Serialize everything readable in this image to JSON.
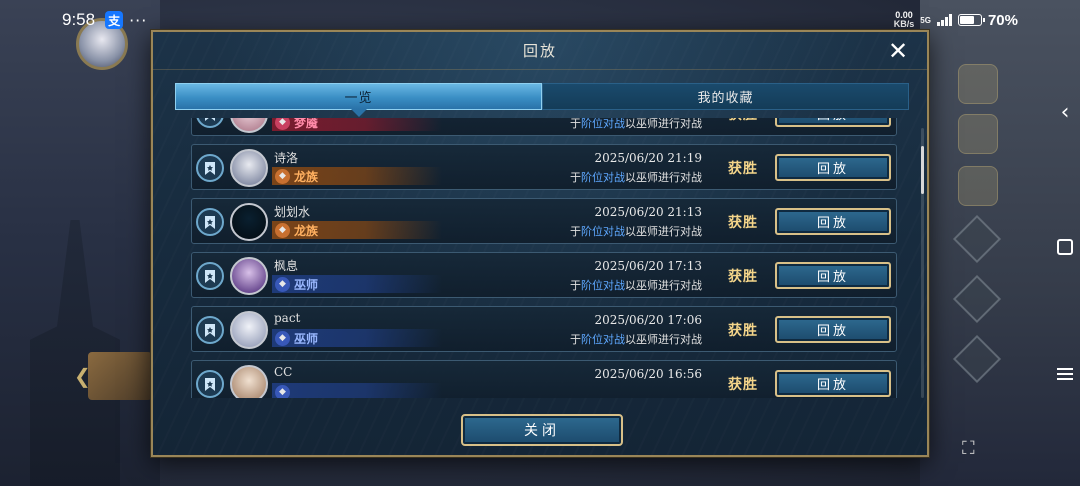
{
  "status_bar": {
    "time": "9:58",
    "app_badge": "支",
    "more": "···",
    "net_speed_value": "0.00",
    "net_speed_unit": "KB/s",
    "net_type": "5G",
    "battery": "70%",
    "battery_level": 0.7
  },
  "dialog": {
    "title": "回放",
    "tabs": [
      {
        "label": "一览",
        "active": true
      },
      {
        "label": "我的收藏",
        "active": false
      }
    ],
    "close_label": "关闭",
    "scroll_position": 0.08
  },
  "replays": [
    {
      "name": "",
      "class": "梦魇",
      "class_theme": "nightmare",
      "date": "",
      "desc_prefix": "于",
      "mode": "阶位对战",
      "desc_suffix": "以巫师进行对战",
      "result": "获胜",
      "button": "回放",
      "avatar": "pink"
    },
    {
      "name": "诗洛",
      "class": "龙族",
      "class_theme": "dragon",
      "date": "2025/06/20  21:19",
      "desc_prefix": "于",
      "mode": "阶位对战",
      "desc_suffix": "以巫师进行对战",
      "result": "获胜",
      "button": "回放",
      "avatar": "silver"
    },
    {
      "name": "划划水",
      "class": "龙族",
      "class_theme": "dragon",
      "date": "2025/06/20  21:13",
      "desc_prefix": "于",
      "mode": "阶位对战",
      "desc_suffix": "以巫师进行对战",
      "result": "获胜",
      "button": "回放",
      "avatar": "dark"
    },
    {
      "name": "枫息",
      "class": "巫师",
      "class_theme": "wizard",
      "date": "2025/06/20  17:13",
      "desc_prefix": "于",
      "mode": "阶位对战",
      "desc_suffix": "以巫师进行对战",
      "result": "获胜",
      "button": "回放",
      "avatar": "purple"
    },
    {
      "name": "pact",
      "class": "巫师",
      "class_theme": "wizard",
      "date": "2025/06/20  17:06",
      "desc_prefix": "于",
      "mode": "阶位对战",
      "desc_suffix": "以巫师进行对战",
      "result": "获胜",
      "button": "回放",
      "avatar": "white"
    },
    {
      "name": "CC",
      "class": "",
      "class_theme": "wizard",
      "date": "2025/06/20  16:56",
      "desc_prefix": "",
      "mode": "",
      "desc_suffix": "",
      "result": "获胜",
      "button": "回放",
      "avatar": "cream"
    }
  ],
  "themes": {
    "nightmare": {
      "band": "#7a1c2e",
      "icon_bg": "#c84060",
      "text": "#ff8aa8"
    },
    "dragon": {
      "band": "#7a4418",
      "icon_bg": "#c87030",
      "text": "#ffb060"
    },
    "wizard": {
      "band": "#1e3a78",
      "icon_bg": "#3858b8",
      "text": "#9ab8ff"
    }
  },
  "avatars": {
    "pink": [
      "#f0d8e0",
      "#b88898"
    ],
    "silver": [
      "#e8eaf0",
      "#8890a8"
    ],
    "dark": [
      "#0a2030",
      "#051018"
    ],
    "purple": [
      "#d8c0e8",
      "#6a4a90"
    ],
    "white": [
      "#f0f2f8",
      "#a0a8c0"
    ],
    "cream": [
      "#f0e0d0",
      "#b09078"
    ]
  }
}
